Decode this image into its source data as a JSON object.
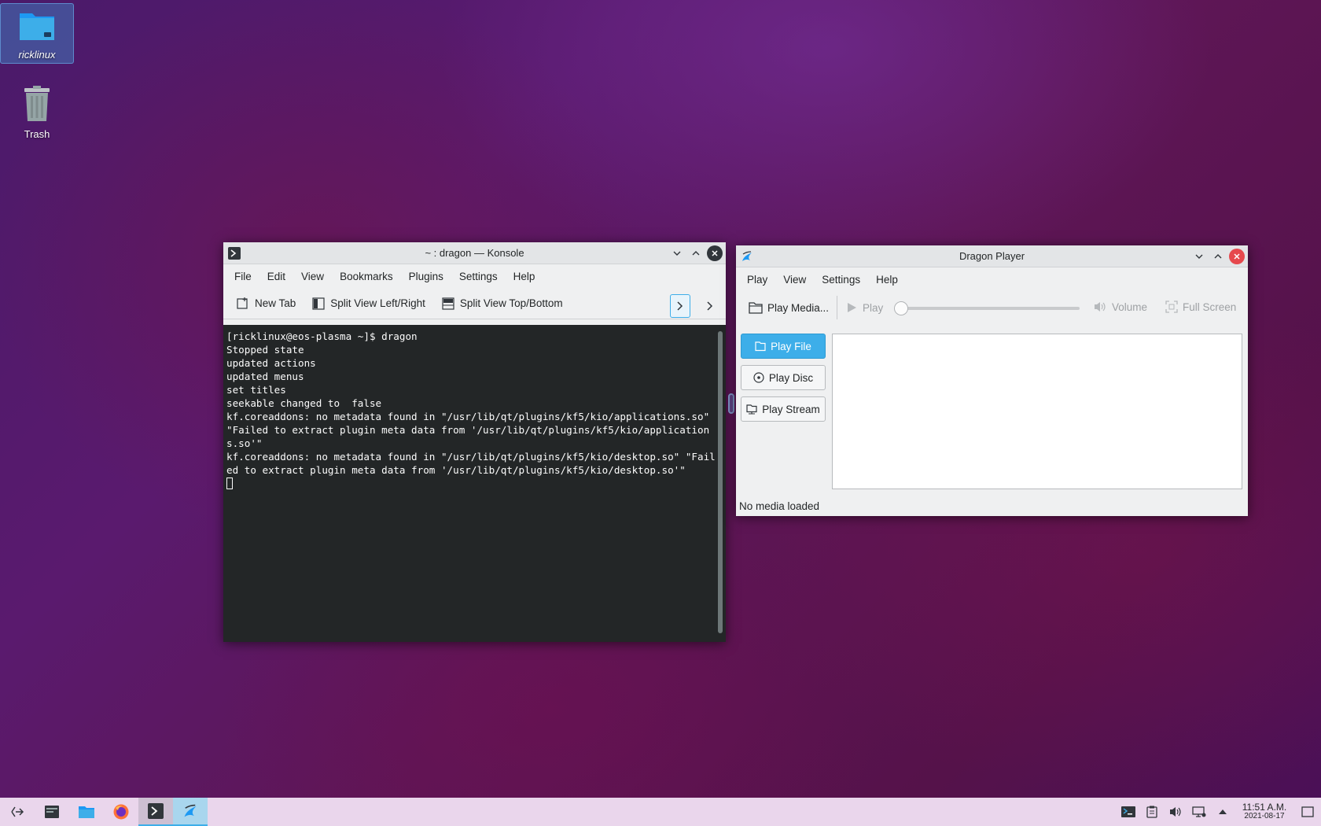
{
  "desktop": {
    "icons": [
      {
        "label": "ricklinux"
      },
      {
        "label": "Trash"
      }
    ]
  },
  "konsole": {
    "title": "~ : dragon — Konsole",
    "menu": [
      "File",
      "Edit",
      "View",
      "Bookmarks",
      "Plugins",
      "Settings",
      "Help"
    ],
    "toolbar": {
      "new_tab": "New Tab",
      "split_lr": "Split View Left/Right",
      "split_tb": "Split View Top/Bottom"
    },
    "terminal": {
      "lines": "[ricklinux@eos-plasma ~]$ dragon\nStopped state\nupdated actions\nupdated menus\nset titles\nseekable changed to  false\nkf.coreaddons: no metadata found in \"/usr/lib/qt/plugins/kf5/kio/applications.so\" \"Failed to extract plugin meta data from '/usr/lib/qt/plugins/kf5/kio/applications.so'\"\nkf.coreaddons: no metadata found in \"/usr/lib/qt/plugins/kf5/kio/desktop.so\" \"Failed to extract plugin meta data from '/usr/lib/qt/plugins/kf5/kio/desktop.so'\"\n"
    }
  },
  "dragon": {
    "title": "Dragon Player",
    "menu": [
      "Play",
      "View",
      "Settings",
      "Help"
    ],
    "toolbar": {
      "play_media": "Play Media...",
      "play": "Play",
      "volume": "Volume",
      "full_screen": "Full Screen"
    },
    "side_buttons": {
      "play_file": "Play File",
      "play_disc": "Play Disc",
      "play_stream": "Play Stream"
    },
    "status": "No media loaded"
  },
  "taskbar": {
    "clock_time": "11:51 A.M.",
    "clock_date": "2021-08-17"
  },
  "colors": {
    "accent": "#3daee9",
    "close_red": "#e6484d",
    "terminal_bg": "#232627"
  }
}
